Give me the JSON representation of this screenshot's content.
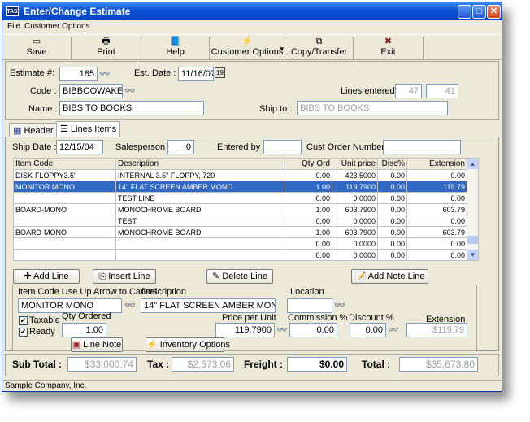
{
  "window": {
    "title": "Enter/Change Estimate",
    "app_icon": "TAS"
  },
  "title_buttons": {
    "minimize": "_",
    "maximize": "□",
    "close": "✕"
  },
  "menu": [
    "File",
    "Customer Options"
  ],
  "toolbar": [
    {
      "label": "Save",
      "icon": "save-icon",
      "glyph": "▭"
    },
    {
      "label": "Print",
      "icon": "printer-icon",
      "glyph": "🖶"
    },
    {
      "label": "Help",
      "icon": "book-icon",
      "glyph": "📘"
    },
    {
      "label": "Customer Options",
      "icon": "lightning-icon",
      "glyph": "⚡",
      "dropdown": "▾"
    },
    {
      "label": "Copy/Transfer",
      "icon": "copy-icon",
      "glyph": "⧉"
    },
    {
      "label": "Exit",
      "icon": "x-icon",
      "glyph": "✖"
    }
  ],
  "header": {
    "estimate_label": "Estimate #:",
    "estimate": "185",
    "est_date_label": "Est. Date :",
    "est_date": "11/16/07",
    "calendar_glyph": "19",
    "code_label": "Code :",
    "code": "BIBBOOWAKE",
    "name_label": "Name :",
    "name": "BIBS TO BOOKS",
    "lines_entered_label": "Lines entered :",
    "lines_entered_a": "47",
    "lines_entered_b": "41",
    "ship_to_label": "Ship to :",
    "ship_to": "BIBS TO BOOKS",
    "binoculars_glyph": "👓"
  },
  "tabs": [
    {
      "label": "Header",
      "icon": "header-icon"
    },
    {
      "label": "Lines Items",
      "icon": "list-icon"
    }
  ],
  "lines": {
    "ship_date_label": "Ship Date :",
    "ship_date": "12/15/04",
    "salesperson_label": "Salesperson :",
    "salesperson": "0",
    "entered_by_label": "Entered by :",
    "entered_by": "",
    "cust_order_label": "Cust Order Number :",
    "cust_order": "",
    "columns": [
      "Item Code",
      "Description",
      "Qty Ord",
      "Unit price",
      "Disc%",
      "Extension"
    ],
    "rows": [
      [
        "DISK-FLOPPY3.5\"",
        "INTERNAL 3.5\" FLOPPY, 720",
        "0.00",
        "423.5000",
        "0.00",
        "0.00"
      ],
      [
        "MONITOR MONO",
        "14\" FLAT SCREEN AMBER MONO",
        "1.00",
        "119.7900",
        "0.00",
        "119.79"
      ],
      [
        "",
        "TEST LINE",
        "0.00",
        "0.0000",
        "0.00",
        "0.00"
      ],
      [
        "BOARD-MONO",
        "MONOCHROME BOARD",
        "1.00",
        "603.7900",
        "0.00",
        "603.79"
      ],
      [
        "",
        "TEST",
        "0.00",
        "0.0000",
        "0.00",
        "0.00"
      ],
      [
        "BOARD-MONO",
        "MONOCHROME BOARD",
        "1.00",
        "603.7900",
        "0.00",
        "603.79"
      ],
      [
        "",
        "",
        "0.00",
        "0.0000",
        "0.00",
        "0.00"
      ],
      [
        "",
        "",
        "0.00",
        "0.0000",
        "0.00",
        "0.00"
      ]
    ],
    "selected_row": 1
  },
  "line_buttons": {
    "add": "Add Line",
    "insert": "Insert Line",
    "delete": "Delete Line",
    "add_note": "Add Note Line"
  },
  "editor": {
    "item_code_label": "Item Code Use Up Arrow to Cancel",
    "item_code": "MONITOR MONO",
    "description_label": "Description",
    "description": "14\" FLAT SCREEN AMBER MONO",
    "location_label": "Location",
    "location": "",
    "taxable_label": "Taxable",
    "taxable": true,
    "ready_label": "Ready",
    "ready": true,
    "qty_label": "Qty Ordered",
    "qty": "1.00",
    "price_label": "Price per Unit",
    "price": "119.7900",
    "commission_label": "Commission %",
    "commission": "0.00",
    "discount_label": "Discount %",
    "discount": "0.00",
    "extension_label": "Extension",
    "extension": "$119.79",
    "line_note": "Line Note",
    "inventory_options": "Inventory Options"
  },
  "totals": {
    "subtotal_label": "Sub Total :",
    "subtotal": "$33,000.74",
    "tax_label": "Tax :",
    "tax": "$2,673.06",
    "freight_label": "Freight :",
    "freight": "$0.00",
    "total_label": "Total :",
    "total": "$35,673.80"
  },
  "status": "Sample Company, Inc."
}
